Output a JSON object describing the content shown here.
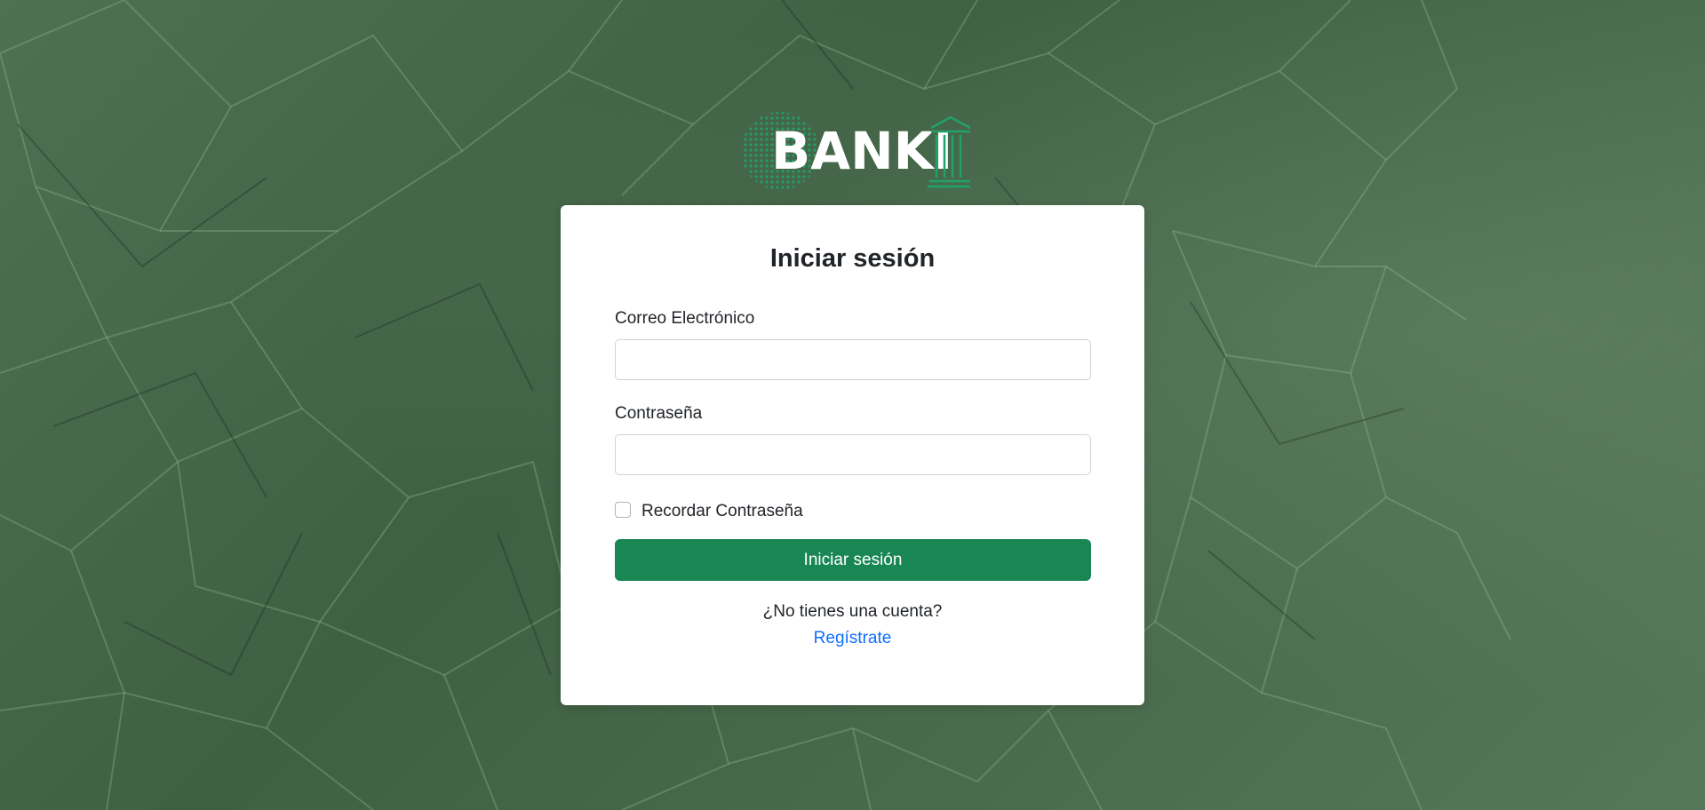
{
  "brand": {
    "name": "BANKI",
    "accent_color": "#1fa36b"
  },
  "login": {
    "title": "Iniciar sesión",
    "email_label": "Correo Electrónico",
    "email_value": "",
    "password_label": "Contraseña",
    "password_value": "",
    "remember_label": "Recordar Contraseña",
    "remember_checked": false,
    "submit_label": "Iniciar sesión",
    "no_account_text": "¿No tienes una cuenta?",
    "register_link": "Regístrate"
  },
  "colors": {
    "background": "#49694c",
    "button": "#198754",
    "link": "#0d6efd"
  }
}
